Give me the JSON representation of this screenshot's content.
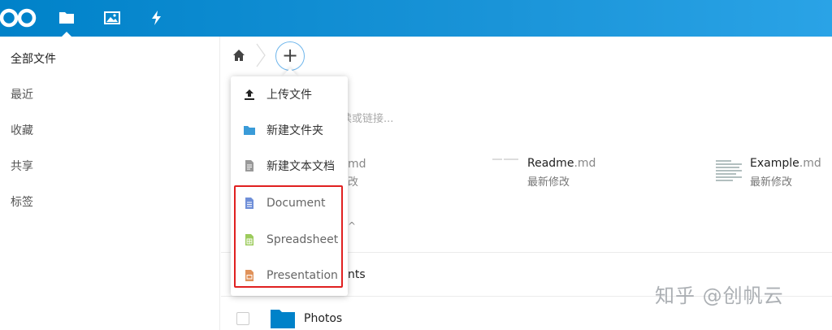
{
  "header": {
    "logo_icon": "nextcloud-logo-icon",
    "apps": [
      {
        "name": "files-icon",
        "active": true
      },
      {
        "name": "photos-icon",
        "active": false
      },
      {
        "name": "activity-icon",
        "active": false
      }
    ],
    "colors": {
      "start": "#0082c9",
      "end": "#2aa3e6"
    }
  },
  "sidebar": {
    "items": [
      {
        "label": "全部文件"
      },
      {
        "label": "最近"
      },
      {
        "label": "收藏"
      },
      {
        "label": "共享"
      },
      {
        "label": "标签"
      }
    ]
  },
  "breadcrumb": {
    "home_icon": "home-icon",
    "add_label": "+"
  },
  "background": {
    "search_hint": "读或链接...",
    "recent_partial_ext": "md",
    "recent_partial_sub": "改",
    "readme": {
      "name": "Readme",
      "ext": ".md",
      "sub": "最新修改"
    },
    "example": {
      "name": "Example",
      "ext": ".md",
      "sub": "最新修改"
    },
    "hidden_marker": "^",
    "row_documents_partial": "nts",
    "row_photos": "Photos"
  },
  "menu": {
    "items": [
      {
        "label": "上传文件",
        "icon": "upload-icon"
      },
      {
        "label": "新建文件夹",
        "icon": "folder-icon"
      },
      {
        "label": "新建文本文档",
        "icon": "text-file-icon"
      },
      {
        "label": "Document",
        "icon": "document-icon"
      },
      {
        "label": "Spreadsheet",
        "icon": "spreadsheet-icon"
      },
      {
        "label": "Presentation",
        "icon": "presentation-icon"
      }
    ],
    "highlight_color": "#e02020"
  },
  "watermark": "知乎 @创帆云"
}
